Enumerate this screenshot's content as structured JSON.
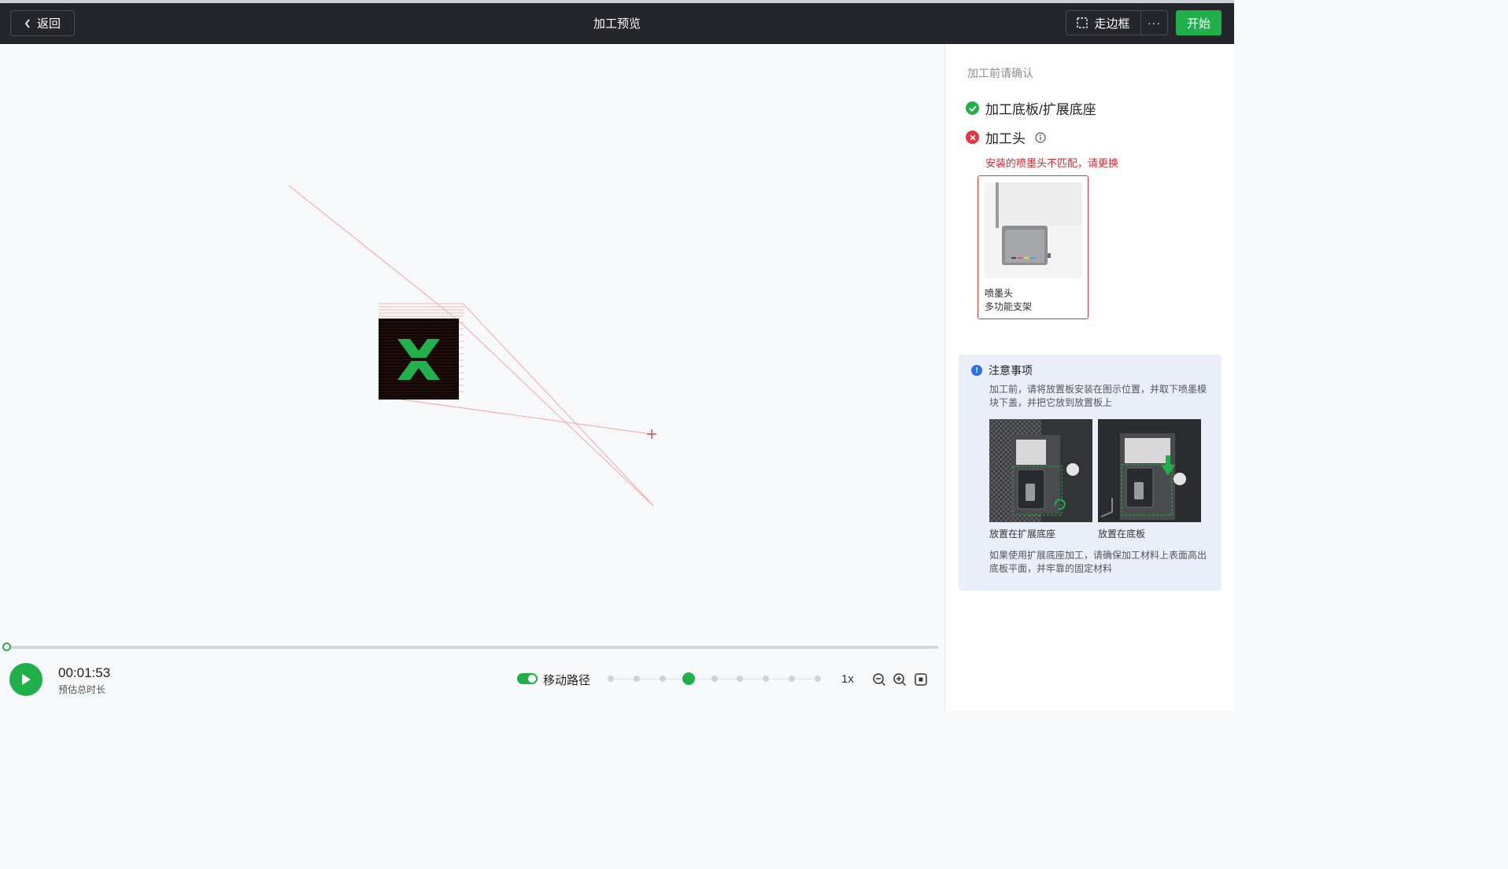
{
  "header": {
    "back_label": "返回",
    "title": "加工预览",
    "framing_label": "走边框",
    "more_label": "···",
    "start_label": "开始"
  },
  "playback": {
    "progress": 0,
    "time": "00:01:53",
    "time_label": "预估总时长",
    "path_toggle_label": "移动路径",
    "path_toggle_on": true,
    "speed_label": "1x",
    "speed_levels": 9,
    "speed_active_index": 3
  },
  "panel": {
    "title": "加工前请确认",
    "checks": [
      {
        "label": "加工底板/扩展底座",
        "status": "ok"
      },
      {
        "label": "加工头",
        "status": "error"
      }
    ],
    "error_message": "安装的喷墨头不匹配，请更换",
    "head_card": {
      "name": "喷墨头",
      "sub": "多功能支架"
    },
    "notice": {
      "title": "注意事项",
      "text_top": "加工前，请将放置板安装在图示位置，并取下喷墨模块下盖，并把它放到放置板上",
      "image_captions": [
        "放置在扩展底座",
        "放置在底板"
      ],
      "text_bottom": "如果使用扩展底座加工，请确保加工材料上表面高出底板平面，并牢靠的固定材料"
    }
  },
  "colors": {
    "accent": "#1fb04a",
    "error": "#e5343f",
    "header_bg": "#25262b",
    "info": "#2f6fe4"
  }
}
